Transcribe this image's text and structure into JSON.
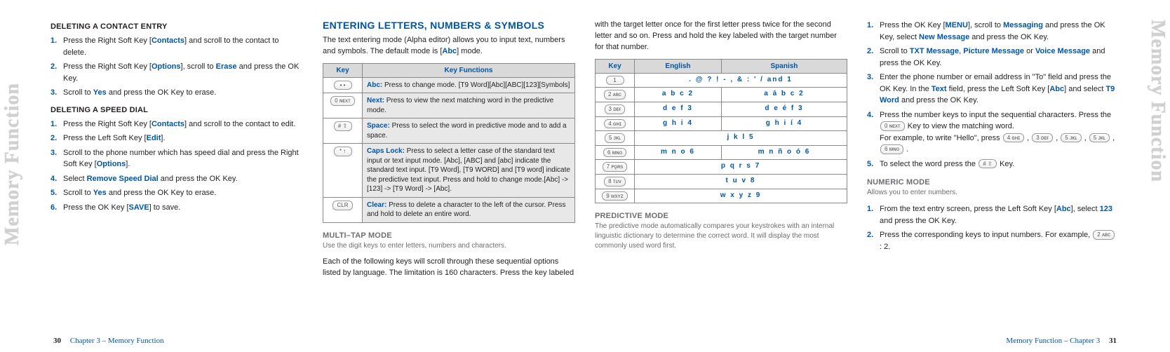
{
  "marginLabel": "Memory Function",
  "col1": {
    "h1": "DELETING A CONTACT ENTRY",
    "l1": [
      "Press the Right Soft Key [<b class='blue'>Contacts</b>] and scroll to the contact to delete.",
      "Press the Right Soft Key [<b class='blue'>Options</b>], scroll to <b class='blue'>Erase</b> and press the OK Key.",
      "Scroll to <b class='blue'>Yes</b> and press the OK Key to erase."
    ],
    "h2": "DELETING A SPEED DIAL",
    "l2": [
      "Press the Right Soft Key [<b class='blue'>Contacts</b>] and scroll to the contact to edit.",
      "Press the Left Soft Key [<b class='blue'>Edit</b>].",
      "Scroll to the phone number which has speed dial and press the Right Soft Key [<b class='blue'>Options</b>].",
      "Select <b class='blue'>Remove Speed Dial</b> and press the OK Key.",
      "Scroll to <b class='blue'>Yes</b> and press the OK Key to erase.",
      "Press the OK Key [<b class='blue'>SAVE</b>] to save."
    ]
  },
  "col2": {
    "title": "ENTERING LETTERS, NUMBERS & SYMBOLS",
    "intro": "The text entering mode (Alpha editor) allows you to input text, numbers and symbols. The default mode is [<b class='blue'>Abc</b>] mode.",
    "th1": "Key",
    "th2": "Key Functions",
    "rows": [
      {
        "k": "• •",
        "t": "<span class='lead'>Abc:</span> Press to change mode. [T9 Word][Abc][ABC][123][Symbols]"
      },
      {
        "k": "0 ɴᴇxᴛ",
        "t": "<span class='lead'>Next:</span> Press to view the next matching word in the predictive mode."
      },
      {
        "k": "# ⇧",
        "t": "<span class='lead'>Space:</span> Press to select the word in predictive mode and to add a space."
      },
      {
        "k": "* ↑",
        "t": "<span class='lead'>Caps Lock:</span> Press to select a letter case of the standard text input or text input mode. [Abc], [ABC] and [abc] indicate the standard text input. [T9 Word], [T9 WORD] and [T9 word] indicate the predictive text input. Press and hold to change mode.[Abc] -> [123] -> [T9 Word] -> [Abc]."
      },
      {
        "k": "CLR",
        "t": "<span class='lead'>Clear:</span> Press to delete a character to the left of the cursor. Press and hold to delete an entire word."
      }
    ],
    "h2": "MULTI–TAP MODE",
    "sub": "Use the digit keys to enter letters, numbers and characters.",
    "p": "Each of the following keys will scroll through these sequential options listed by language. The limitation is 160 characters. Press the key labeled"
  },
  "col3": {
    "top": "with the target letter once for the first letter press twice for the second letter and so on. Press and hold the key labeled with the target number for that number.",
    "th1": "Key",
    "th2": "English",
    "th3": "Spanish",
    "rows": [
      {
        "k": "1",
        "e": ". @ ? ! - , & : ' / and 1",
        "s": ""
      },
      {
        "k": "2 ᴀʙᴄ",
        "e": "a b c 2",
        "s": "a á b c 2"
      },
      {
        "k": "3 ᴅᴇғ",
        "e": "d e f 3",
        "s": "d e é f 3"
      },
      {
        "k": "4 ɢʜɪ",
        "e": "g h i 4",
        "s": "g h i í 4"
      },
      {
        "k": "5 ᴊᴋʟ",
        "e": "j k l 5",
        "s": ""
      },
      {
        "k": "6 ᴍɴᴏ",
        "e": "m n o 6",
        "s": "m n ñ o ó 6"
      },
      {
        "k": "7 ᴘǫʀs",
        "e": "p q r s 7",
        "s": ""
      },
      {
        "k": "8 ᴛᴜᴠ",
        "e": "t u v 8",
        "s": ""
      },
      {
        "k": "9 ᴡxʏᴢ",
        "e": "w x y z 9",
        "s": ""
      }
    ],
    "h2": "PREDICTIVE MODE",
    "sub": "The predictive mode automatically compares your keystrokes with an internal linguistic dictionary to determine the correct word. It will display the most commonly used word first."
  },
  "col4": {
    "l1": [
      "Press the OK Key [<b class='blue'>MENU</b>], scroll to <b class='blue'>Messaging</b> and press the OK Key, select <b class='blue'>New Message</b> and press the OK Key.",
      "Scroll to <b class='blue'>TXT Message</b>, <b class='blue'>Picture Message</b> or <b class='blue'>Voice Message</b> and press the OK Key.",
      "Enter the phone number or email address in \"To\" field and press the OK Key. In the <b class='blue'>Text</b> field, press the Left Soft Key [<b class='blue'>Abc</b>] and select <b class='blue'>T9 Word</b> and press the OK Key.",
      "Press the number keys to input the sequential characters. Press the <span class='keybtn'>0 ɴᴇxᴛ</span> Key to view the matching word.<br>For example, to write \"Hello\", press <span class='keybtn'>4 ɢʜɪ</span> , <span class='keybtn'>3 ᴅᴇғ</span> , <span class='keybtn'>5 ᴊᴋʟ</span> , <span class='keybtn'>5 ᴊᴋʟ</span> , <span class='keybtn'>6 ᴍɴᴏ</span> .",
      "To select the word press the <span class='keybtn'># ⇧</span> Key."
    ],
    "h2": "NUMERIC MODE",
    "sub": "Allows you to enter numbers.",
    "l2": [
      "From the text entry screen, press the Left Soft Key [<b class='blue'>Abc</b>], select <b class='blue'>123</b> and press the OK Key.",
      "Press the corresponding keys to input numbers. For example, <span class='keybtn'>2 ᴀʙᴄ</span> : 2."
    ]
  },
  "footer": {
    "leftNum": "30",
    "leftText": "Chapter 3 – Memory Function",
    "rightText": "Memory Function – Chapter 3",
    "rightNum": "31"
  }
}
